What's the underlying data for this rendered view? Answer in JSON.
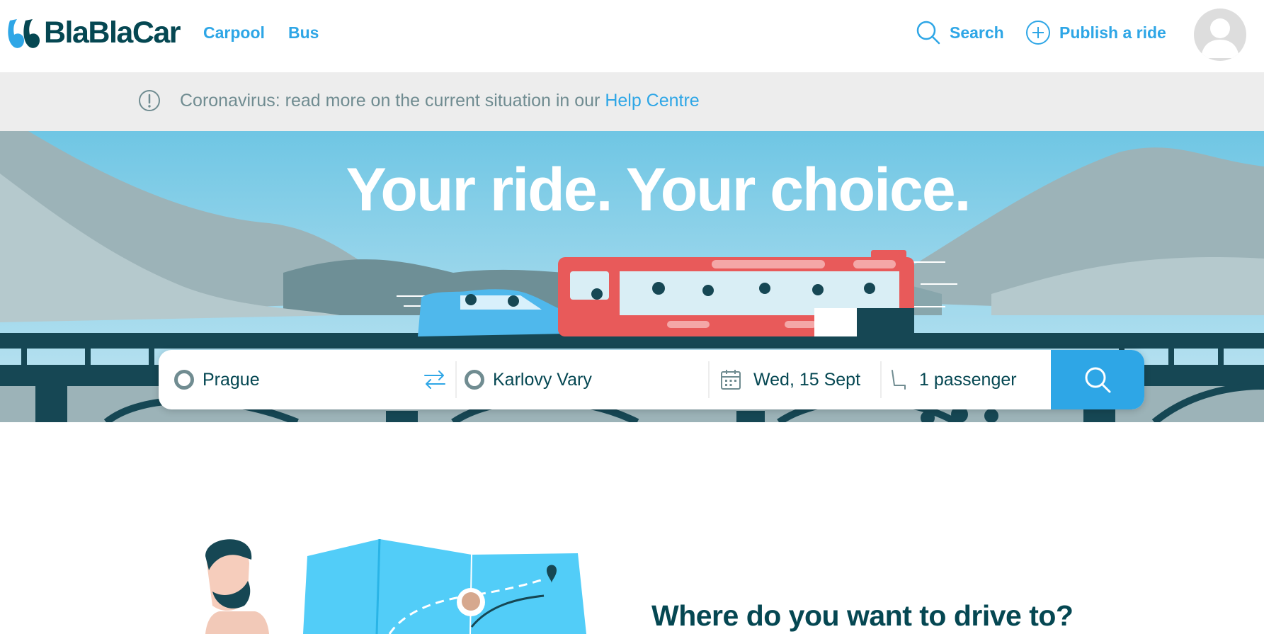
{
  "header": {
    "logo_text": "BlaBlaCar",
    "nav": {
      "carpool": "Carpool",
      "bus": "Bus"
    },
    "search_label": "Search",
    "publish_label": "Publish a ride"
  },
  "notice": {
    "text": "Coronavirus: read more on the current situation in our ",
    "link": "Help Centre"
  },
  "hero": {
    "title": "Your ride. Your choice."
  },
  "search": {
    "from": "Prague",
    "to": "Karlovy Vary",
    "date": "Wed, 15 Sept",
    "passengers": "1 passenger"
  },
  "lower": {
    "title": "Where do you want to drive to?"
  },
  "colors": {
    "brand_blue": "#2ea6e6",
    "brand_dark": "#054752",
    "bus_red": "#e85a5a",
    "sky": "#7fcbe6"
  },
  "icons": [
    "logo-mark-icon",
    "search-icon",
    "plus-circle-icon",
    "user-avatar-icon",
    "info-icon",
    "swap-arrows-icon",
    "calendar-icon",
    "seat-icon",
    "search-button-icon"
  ]
}
